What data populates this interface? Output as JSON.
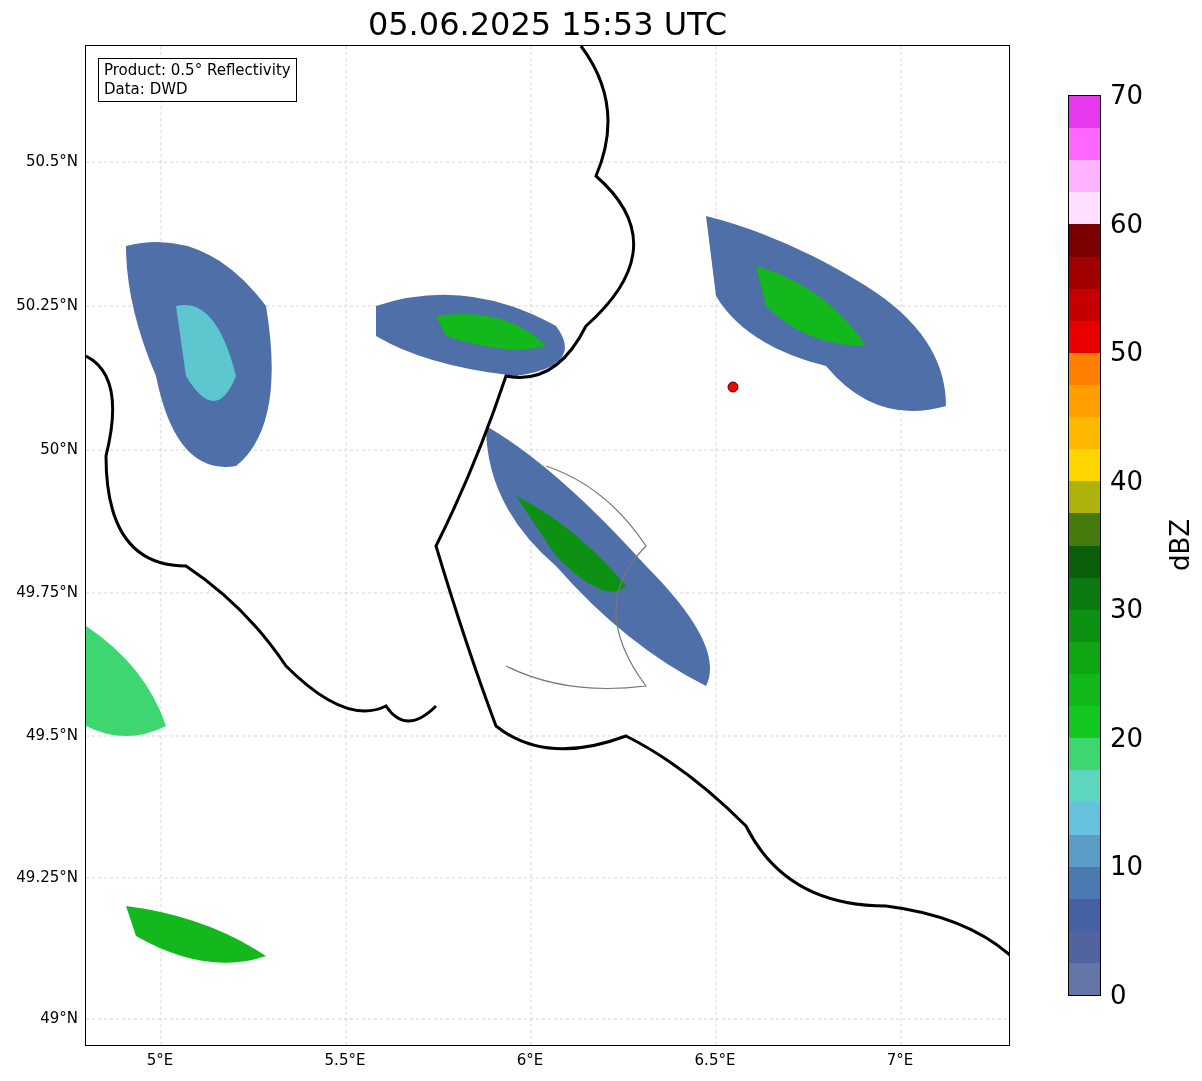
{
  "title": "05.06.2025 15:53 UTC",
  "info_box": [
    "Product: 0.5° Reflectivity",
    "Data: DWD"
  ],
  "y_ticks": [
    "50.5°N",
    "50.25°N",
    "50°N",
    "49.75°N",
    "49.5°N",
    "49.25°N",
    "49°N"
  ],
  "x_ticks": [
    "5°E",
    "5.5°E",
    "6°E",
    "6.5°E",
    "7°E"
  ],
  "colorbar": {
    "label": "dBZ",
    "ticks": [
      "70",
      "60",
      "50",
      "40",
      "30",
      "20",
      "10",
      "0"
    ],
    "segments": [
      {
        "color": "#e838ef"
      },
      {
        "color": "#ff66ff"
      },
      {
        "color": "#ffb3ff"
      },
      {
        "color": "#ffdfff"
      },
      {
        "color": "#7c0000"
      },
      {
        "color": "#a00000"
      },
      {
        "color": "#c40000"
      },
      {
        "color": "#e80000"
      },
      {
        "color": "#ff7f00"
      },
      {
        "color": "#ff9e00"
      },
      {
        "color": "#ffb800"
      },
      {
        "color": "#ffd600"
      },
      {
        "color": "#adb20c"
      },
      {
        "color": "#467a0c"
      },
      {
        "color": "#0a5e0c"
      },
      {
        "color": "#0b7a10"
      },
      {
        "color": "#0c9112"
      },
      {
        "color": "#0fa614"
      },
      {
        "color": "#10b81a"
      },
      {
        "color": "#13c81f"
      },
      {
        "color": "#3ed670"
      },
      {
        "color": "#5dd6c0"
      },
      {
        "color": "#66c1dc"
      },
      {
        "color": "#5a9cc6"
      },
      {
        "color": "#4a7ab0"
      },
      {
        "color": "#4560a3"
      },
      {
        "color": "#5264a0"
      },
      {
        "color": "#6475a6"
      }
    ]
  }
}
